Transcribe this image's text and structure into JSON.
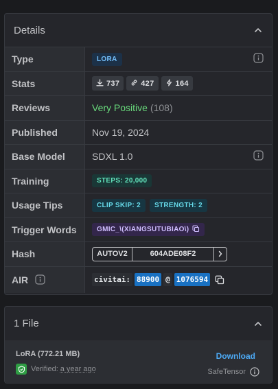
{
  "details": {
    "title": "Details",
    "rows": {
      "type": {
        "label": "Type",
        "badge": "LORA"
      },
      "stats": {
        "label": "Stats",
        "downloads": "737",
        "generations": "427",
        "boosts": "164"
      },
      "reviews": {
        "label": "Reviews",
        "sentiment": "Very Positive",
        "count": "(108)"
      },
      "published": {
        "label": "Published",
        "date": "Nov 19, 2024"
      },
      "base_model": {
        "label": "Base Model",
        "value": "SDXL 1.0"
      },
      "training": {
        "label": "Training",
        "steps": "STEPS: 20,000"
      },
      "usage_tips": {
        "label": "Usage Tips",
        "clip_skip": "CLIP SKIP: 2",
        "strength": "STRENGTH: 2"
      },
      "trigger_words": {
        "label": "Trigger Words",
        "word": "GMIC_\\(XIANGSUTUBIAO\\)"
      },
      "hash": {
        "label": "Hash",
        "algo": "AUTOV2",
        "value": "604ADE08F2"
      },
      "air": {
        "label": "AIR",
        "prefix": "civitai:",
        "model_id": "88900",
        "at": "@",
        "version_id": "1076594"
      }
    }
  },
  "files": {
    "title": "1 File",
    "file_name": "LoRA (772.21 MB)",
    "download": "Download",
    "verified_label": "Verified:",
    "verified_date": "a year ago",
    "format": "SafeTensor"
  },
  "colors": {
    "background": "#1a1b1e",
    "panel": "#25262b",
    "accent_blue": "#4dabf7",
    "positive_green": "#69db7c",
    "highlight_blue": "#1971c2"
  }
}
